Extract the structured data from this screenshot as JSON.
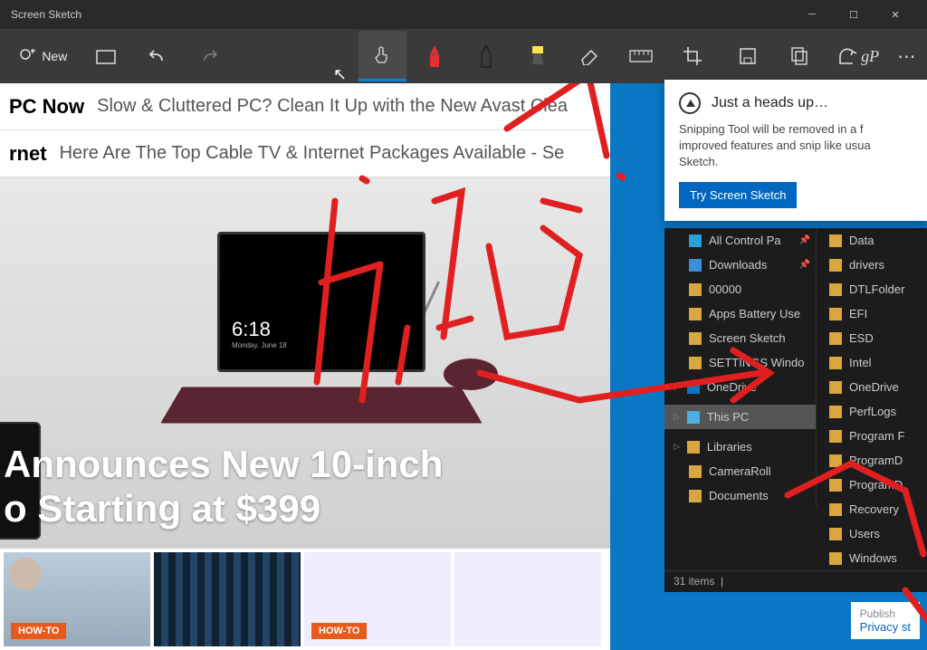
{
  "app": {
    "title": "Screen Sketch"
  },
  "toolbar": {
    "new": "New"
  },
  "ads": {
    "l1": "PC Now",
    "r1": "Slow & Cluttered PC? Clean It Up with the New Avast Clea",
    "l2": "rnet",
    "r2": "Here Are The Top Cable TV & Internet Packages Available - Se"
  },
  "hero": {
    "clock": "6:18",
    "clock_sub": "Monday, June 18",
    "headline_1": "Announces New 10-inch",
    "headline_2": "o Starting at $399"
  },
  "badge": "HOW-TO",
  "notify": {
    "title": "Just a heads up…",
    "body": "Snipping Tool will be removed in a f improved features and snip like usua Sketch.",
    "button": "Try Screen Sketch"
  },
  "nav": [
    {
      "icon": "ic-cpl",
      "label": "All Control Pa",
      "pin": true
    },
    {
      "icon": "ic-dl",
      "label": "Downloads",
      "pin": true
    },
    {
      "icon": "ic-f",
      "label": "00000"
    },
    {
      "icon": "ic-f",
      "label": "Apps Battery Use"
    },
    {
      "icon": "ic-f",
      "label": "Screen Sketch"
    },
    {
      "icon": "ic-f",
      "label": "SETTINGS Windo"
    },
    {
      "icon": "ic-od",
      "label": "OneDrive",
      "chev": true
    },
    {
      "icon": "ic-pc",
      "label": "This PC",
      "sel": true,
      "chev": true
    },
    {
      "icon": "ic-lib",
      "label": "Libraries",
      "chev": true
    },
    {
      "icon": "ic-f",
      "label": "CameraRoll"
    },
    {
      "icon": "ic-f",
      "label": "Documents"
    }
  ],
  "files": [
    "Data",
    "drivers",
    "DTLFolder",
    "EFI",
    "ESD",
    "Intel",
    "OneDrive",
    "PerfLogs",
    "Program F",
    "ProgramD",
    "ProgramD",
    "Recovery",
    "Users",
    "Windows"
  ],
  "status": "31 items",
  "privacy": {
    "pub": "Publish",
    "link": "Privacy st"
  }
}
